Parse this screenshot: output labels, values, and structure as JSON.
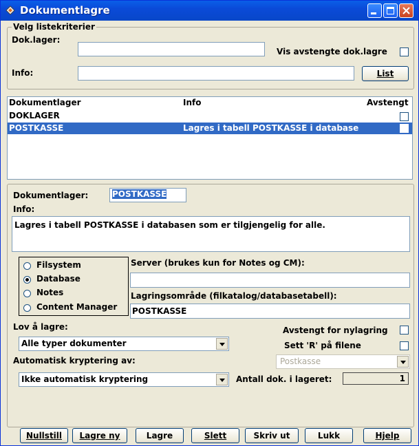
{
  "window": {
    "title": "Dokumentlagre",
    "controls": [
      "minimize-icon",
      "maximize-icon",
      "close-icon"
    ]
  },
  "criteria": {
    "group_label": "Velg listekriterier",
    "doklager_label": "Dok.lager:",
    "doklager_value": "",
    "vis_label": "Vis avstengte dok.lagre",
    "vis_checked": false,
    "info_label": "Info:",
    "info_value": "",
    "list_button": "List"
  },
  "table": {
    "columns": [
      "Dokumentlager",
      "Info",
      "Avstengt"
    ],
    "rows": [
      {
        "name": "DOKLAGER",
        "info": "",
        "avstengt": false,
        "selected": false
      },
      {
        "name": "POSTKASSE",
        "info": "Lagres i tabell POSTKASSE i database",
        "avstengt": false,
        "selected": true
      }
    ]
  },
  "detail": {
    "dokumentlager_label": "Dokumentlager:",
    "dokumentlager_value": "POSTKASSE",
    "info_label": "Info:",
    "info_value": "Lagres i tabell POSTKASSE i databasen som er tilgjengelig for alle.",
    "storage_options": [
      {
        "label": "Filsystem",
        "selected": false
      },
      {
        "label": "Database",
        "selected": true
      },
      {
        "label": "Notes",
        "selected": false
      },
      {
        "label": "Content Manager",
        "selected": false
      }
    ],
    "server_label": "Server (brukes kun for Notes og CM):",
    "server_value": "",
    "lagringsomrade_label": "Lagringsområde (filkatalog/databasetabell):",
    "lagringsomrade_value": "POSTKASSE",
    "lov_label": "Lov å lagre:",
    "lov_value": "Alle typer dokumenter",
    "avstengt_nylagring_label": "Avstengt for nylagring",
    "avstengt_nylagring_checked": false,
    "sett_r_label": "Sett 'R' på filene",
    "sett_r_checked": false,
    "postkasse_combo_value": "Postkasse",
    "kryptering_label": "Automatisk kryptering av:",
    "kryptering_value": "Ikke automatisk kryptering",
    "antall_label": "Antall dok. i lageret:",
    "antall_value": "1"
  },
  "buttons": {
    "nullstill": "Nullstill",
    "lagre_ny": "Lagre ny",
    "lagre": "Lagre",
    "slett": "Slett",
    "skriv_ut": "Skriv ut",
    "lukk": "Lukk",
    "hjelp": "Hjelp"
  },
  "colors": {
    "titlebar": "#0a4ad8",
    "selection": "#316ac5",
    "dialog_bg": "#ece9d8"
  }
}
